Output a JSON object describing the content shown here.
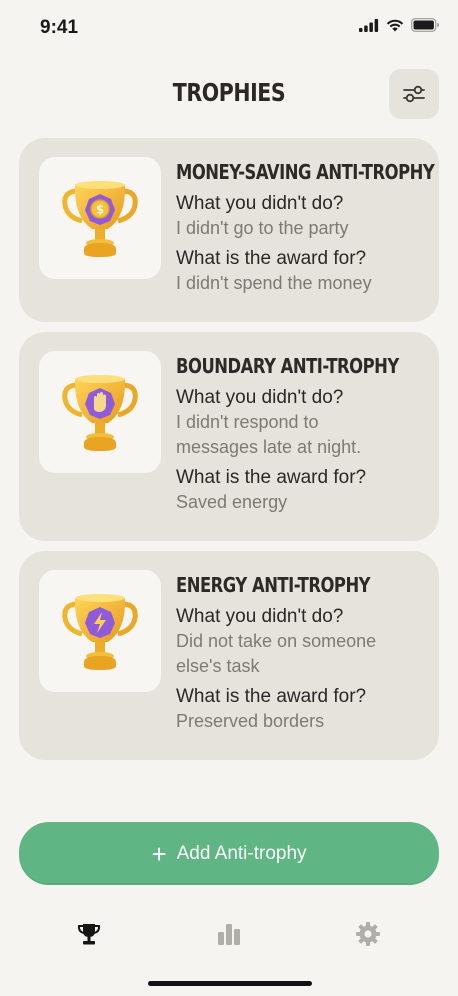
{
  "status_bar": {
    "time": "9:41"
  },
  "header": {
    "title": "TROPHIES",
    "filter_icon": "sliders-icon"
  },
  "cards": [
    {
      "title": "MONEY-SAVING ANTI-TROPHY",
      "question_1": "What you didn't do?",
      "answer_1": "I didn't go to the party",
      "question_2": "What is the award for?",
      "answer_2": "I didn't spend the money",
      "badge_icon": "coin-icon"
    },
    {
      "title": "BOUNDARY ANTI-TROPHY",
      "question_1": "What you didn't do?",
      "answer_1": "I didn't respond to messages late at night.",
      "question_2": "What is the award for?",
      "answer_2": "Saved energy",
      "badge_icon": "hand-icon"
    },
    {
      "title": "ENERGY ANTI-TROPHY",
      "question_1": "What you didn't do?",
      "answer_1": "Did not take on someone else's task",
      "question_2": "What is the award for?",
      "answer_2": "Preserved borders",
      "badge_icon": "lightning-icon"
    }
  ],
  "add_button": {
    "label": "Add Anti-trophy"
  },
  "tab_bar": {
    "items": [
      {
        "icon": "trophy-icon",
        "active": true
      },
      {
        "icon": "bar-chart-icon",
        "active": false
      },
      {
        "icon": "gear-icon",
        "active": false
      }
    ]
  },
  "colors": {
    "background": "#f6f4f0",
    "card": "#e6e3dd",
    "accent_green": "#5fb684",
    "trophy_gold": "#f2b733",
    "badge_purple": "#8c5ad9"
  }
}
